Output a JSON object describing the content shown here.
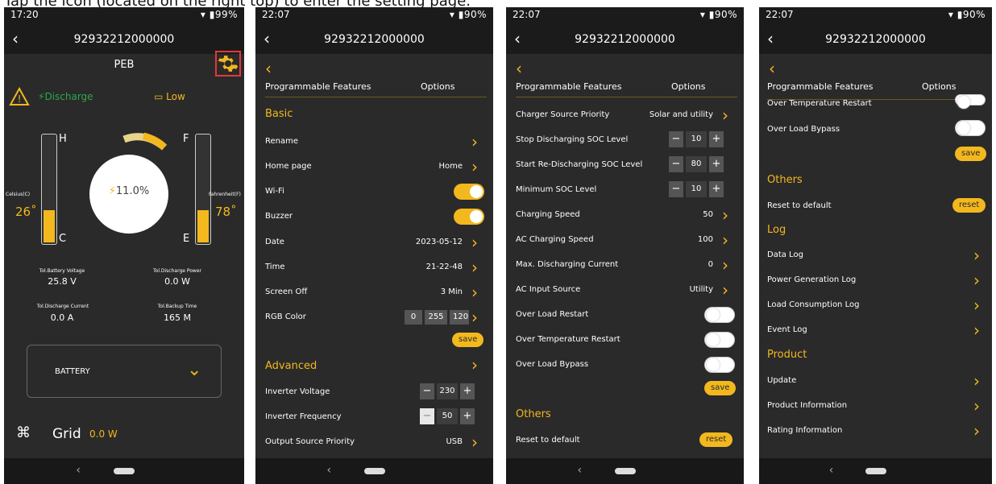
{
  "caption": "Tap the icon (located on the right top) to enter the setting page.",
  "colors": {
    "accent": "#f3b81e",
    "bg": "#2a2a2a",
    "green": "#2aa84a",
    "highlight": "#e53935"
  },
  "s1": {
    "status_time": "17:20",
    "status_right": "▾ ▮99%",
    "title": "92932212000000",
    "peb": "PEB",
    "discharge": "Discharge",
    "low": "Low",
    "gauge_h": "H",
    "gauge_c": "C",
    "gauge_f": "F",
    "gauge_e": "E",
    "celsius_label": "Celsius(C)",
    "celsius_val": "26˚",
    "fahrenheit_label": "Fahrenheit(F)",
    "fahrenheit_val": "78˚",
    "soc": "11.0%",
    "stats": [
      {
        "label": "Tol.Battery Voltage",
        "value": "25.8 V"
      },
      {
        "label": "Tol.Discharge Power",
        "value": "0.0 W"
      },
      {
        "label": "Tol.Discharge Current",
        "value": "0.0 A"
      },
      {
        "label": "Tol.Backup Time",
        "value": "165 M"
      }
    ],
    "battery_dropdown": "BATTERY",
    "grid_label": "Grid",
    "grid_value": "0.0 W"
  },
  "s2": {
    "status_time": "22:07",
    "status_right": "▾ ▮90%",
    "title": "92932212000000",
    "col1": "Programmable Features",
    "col2": "Options",
    "basic": "Basic",
    "rename": "Rename",
    "home_page": "Home page",
    "home_page_val": "Home",
    "wifi": "Wi-Fi",
    "buzzer": "Buzzer",
    "date": "Date",
    "date_val": "2023-05-12",
    "time": "Time",
    "time_val": "21-22-48",
    "screen_off": "Screen Off",
    "screen_off_val": "3 Min",
    "rgb": "RGB Color",
    "rgb_vals": [
      "0",
      "255",
      "120"
    ],
    "save": "save",
    "advanced": "Advanced",
    "inv_voltage": "Inverter Voltage",
    "inv_voltage_val": "230",
    "inv_freq": "Inverter Frequency",
    "inv_freq_val": "50",
    "out_src": "Output Source Priority",
    "out_src_val": "USB"
  },
  "s3": {
    "status_time": "22:07",
    "status_right": "▾ ▮90%",
    "title": "92932212000000",
    "col1": "Programmable Features",
    "col2": "Options",
    "charger_src": "Charger Source Priority",
    "charger_src_val": "Solar and utility",
    "stop_soc": "Stop Discharging SOC Level",
    "stop_soc_val": "10",
    "start_soc": "Start Re-Discharging SOC Level",
    "start_soc_val": "80",
    "min_soc": "Minimum SOC Level",
    "min_soc_val": "10",
    "charging_speed": "Charging Speed",
    "charging_speed_val": "50",
    "ac_charging": "AC Charging Speed",
    "ac_charging_val": "100",
    "max_dis": "Max. Discharging Current",
    "max_dis_val": "0",
    "ac_input": "AC Input Source",
    "ac_input_val": "Utility",
    "ol_restart": "Over Load Restart",
    "ot_restart": "Over Temperature Restart",
    "ol_bypass": "Over Load Bypass",
    "save": "save",
    "others": "Others",
    "reset_default": "Reset to default",
    "reset": "reset"
  },
  "s4": {
    "status_time": "22:07",
    "status_right": "▾ ▮90%",
    "title": "92932212000000",
    "col1": "Programmable Features",
    "col2": "Options",
    "ot_restart": "Over Temperature Restart",
    "ol_bypass": "Over Load Bypass",
    "save": "save",
    "others": "Others",
    "reset_default": "Reset to default",
    "reset": "reset",
    "log": "Log",
    "data_log": "Data Log",
    "power_log": "Power Generation Log",
    "load_log": "Load Consumption Log",
    "event_log": "Event Log",
    "product": "Product",
    "update": "Update",
    "product_info": "Product Information",
    "rating_info": "Rating Information"
  }
}
